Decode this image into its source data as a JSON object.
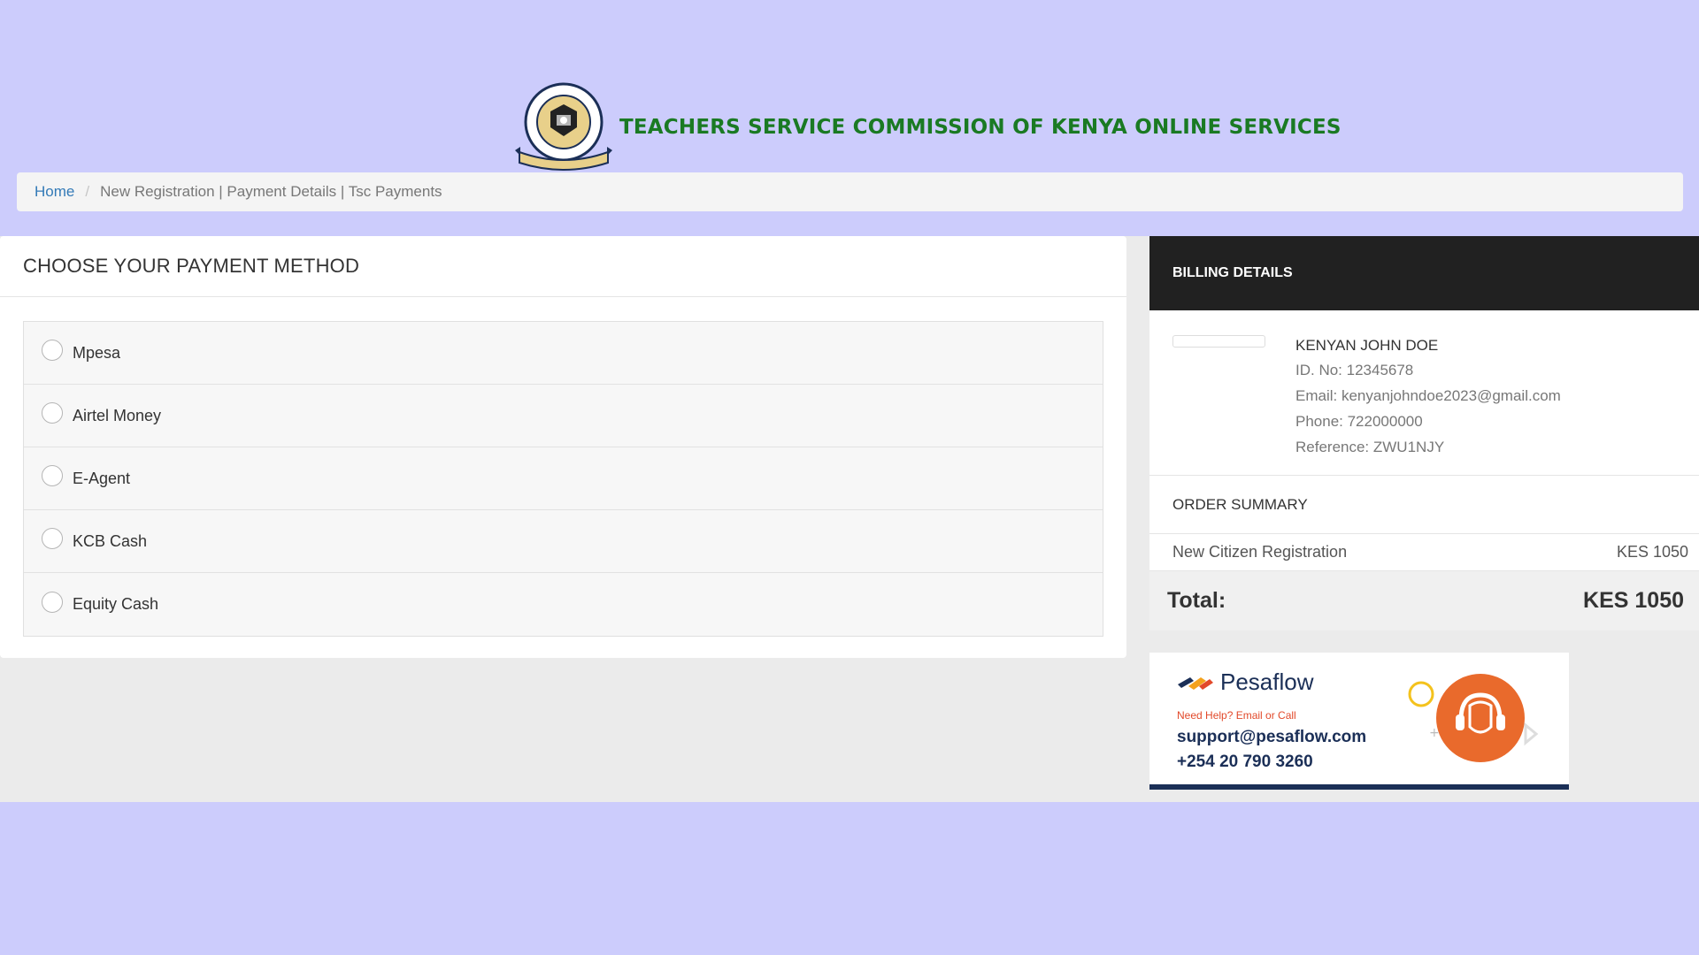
{
  "header": {
    "title": "TEACHERS SERVICE COMMISSION OF KENYA ONLINE SERVICES",
    "logo_icon": "tsc-emblem-logo",
    "logo_text_top": "TEACHERS SERVICE COMMISSION",
    "logo_text_bottom": "KENYA"
  },
  "breadcrumb": {
    "home": "Home",
    "separator": "/",
    "current": "New Registration | Payment Details | Tsc Payments"
  },
  "payment": {
    "title": "CHOOSE YOUR PAYMENT METHOD",
    "methods": [
      "Mpesa",
      "Airtel Money",
      "E-Agent",
      "KCB Cash",
      "Equity Cash"
    ]
  },
  "billing": {
    "title": "BILLING DETAILS",
    "name": "KENYAN JOHN DOE",
    "id_line": "ID. No: 12345678",
    "email_line": "Email: kenyanjohndoe2023@gmail.com",
    "phone_line": "Phone: 722000000",
    "reference_line": "Reference: ZWU1NJY",
    "order_title": "ORDER SUMMARY",
    "order_item": "New Citizen Registration",
    "order_amount": "KES 1050",
    "total_label": "Total:",
    "total_amount": "KES 1050"
  },
  "pesaflow": {
    "brand": "Pesaflow",
    "help": "Need Help? Email or Call",
    "email": "support@pesaflow.com",
    "phone": "+254 20 790 3260",
    "support_icon": "headset-support-icon"
  },
  "colors": {
    "page_bg": "#ccccfc",
    "title_green": "#1a7a23",
    "link_blue": "#337ab7",
    "billing_head_bg": "#212121",
    "pesaflow_navy": "#1b2f57",
    "pesaflow_orange": "#e2492a"
  }
}
